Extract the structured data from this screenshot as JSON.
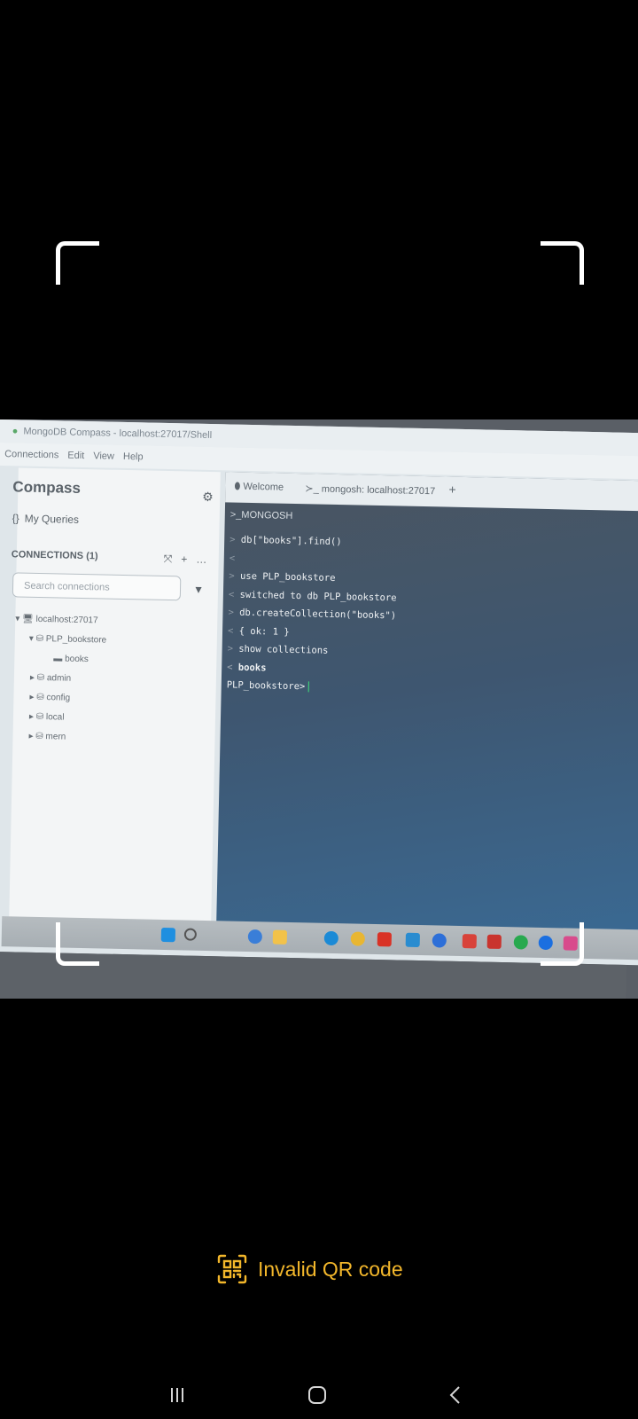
{
  "scanner": {
    "status_text": "Invalid QR code",
    "status_color": "#f3b72b",
    "status_icon": "qr-code-icon"
  },
  "compass": {
    "window_title": "MongoDB Compass - localhost:27017/Shell",
    "menu": [
      "Connections",
      "Edit",
      "View",
      "Help"
    ],
    "sidebar": {
      "title": "Compass",
      "my_queries": "My Queries",
      "connections_header": "CONNECTIONS (1)",
      "search_placeholder": "Search connections",
      "tree": {
        "host": "localhost:27017",
        "databases": [
          {
            "name": "PLP_bookstore",
            "expanded": true,
            "collections": [
              "books"
            ]
          },
          {
            "name": "admin"
          },
          {
            "name": "config"
          },
          {
            "name": "local"
          },
          {
            "name": "mern"
          }
        ]
      }
    },
    "tabs": [
      "Welcome",
      "mongosh: localhost:27017"
    ],
    "shell": {
      "header": ">_MONGOSH",
      "lines": [
        {
          "prefix": ">",
          "text": "db[\"books\"].find()"
        },
        {
          "prefix": "<",
          "text": ""
        },
        {
          "prefix": ">",
          "text": "use PLP_bookstore"
        },
        {
          "prefix": "<",
          "text": "switched to db PLP_bookstore"
        },
        {
          "prefix": ">",
          "text": "db.createCollection(\"books\")"
        },
        {
          "prefix": "<",
          "text": "{ ok: 1 }"
        },
        {
          "prefix": ">",
          "text": "show collections"
        },
        {
          "prefix": "<",
          "text": "books"
        }
      ],
      "prompt": "PLP_bookstore>"
    }
  },
  "android_nav": {
    "recent": "recents-icon",
    "home": "home-icon",
    "back": "back-icon"
  }
}
